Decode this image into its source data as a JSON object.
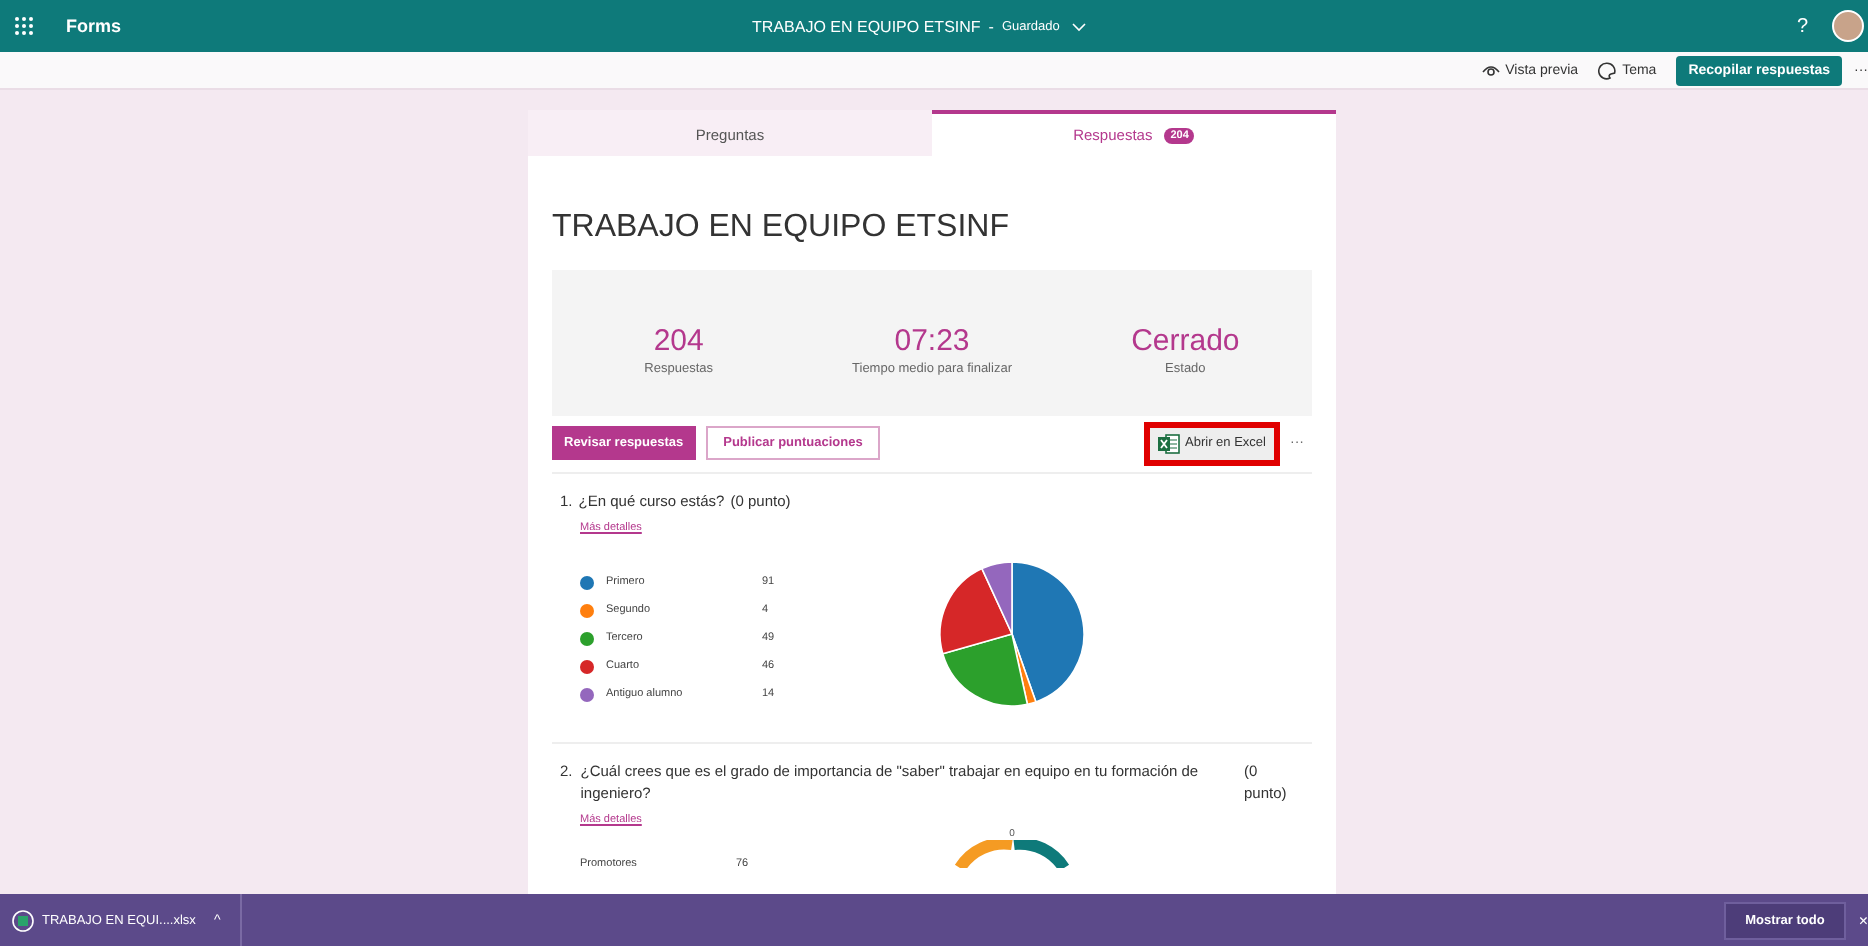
{
  "app_bar": {
    "app_name": "Forms",
    "title": "TRABAJO EN EQUIPO ETSINF",
    "separator": "-",
    "save_state": "Guardado",
    "help": "?"
  },
  "toolbar": {
    "items": [
      {
        "kind": "preview",
        "label": "Vista previa"
      },
      {
        "kind": "theme",
        "label": "Tema"
      }
    ],
    "primary_button": "Recopilar respuestas",
    "more": "···"
  },
  "tabs": [
    {
      "label": "Preguntas",
      "selected": false
    },
    {
      "label": "Respuestas",
      "badge": "204",
      "selected": true
    }
  ],
  "form_title": "TRABAJO EN EQUIPO ETSINF",
  "stats": [
    {
      "value": "204",
      "label": "Respuestas"
    },
    {
      "value": "07:23",
      "label": "Tiempo medio para finalizar"
    },
    {
      "value": "Cerrado",
      "label": "Estado"
    }
  ],
  "actions": {
    "review": "Revisar respuestas",
    "publish": "Publicar puntuaciones",
    "excel": "Abrir en Excel",
    "excel_highlighted": true,
    "more": "···"
  },
  "questions": [
    {
      "kind": "pie",
      "number": "1.",
      "text": "¿En qué curso estás?",
      "points": "(0 punto)",
      "details_link": "Más detalles",
      "legend": [
        {
          "count": "91",
          "color": "#1f77b4"
        },
        {
          "count": "4",
          "color": "#ff7f0e"
        },
        {
          "count": "49",
          "color": "#2ca02c"
        },
        {
          "count": "46",
          "color": "#d62728"
        },
        {
          "count": "14",
          "color": "#9467bd"
        }
      ],
      "chart_data": {
        "type": "pie",
        "categories": [
          "Primero",
          "Segundo",
          "Tercero",
          "Cuarto",
          "Antiguo alumno"
        ],
        "values": [
          44.61,
          1.96,
          24.02,
          22.55,
          6.86
        ]
      }
    },
    {
      "kind": "gauge",
      "number": "2.",
      "text": "¿Cuál crees que es el grado de importancia de \"saber\" trabajar en equipo en tu formación de ingeniero?",
      "points": "(0 punto)",
      "details_link": "Más detalles",
      "legend": [
        {
          "label": "Promotores",
          "count": "76"
        }
      ],
      "gauge_label": "0"
    }
  ],
  "download_bar": {
    "file": "TRABAJO EN EQUI....xlsx",
    "caret": "^",
    "show_all": "Mostrar todo",
    "close": "×"
  }
}
